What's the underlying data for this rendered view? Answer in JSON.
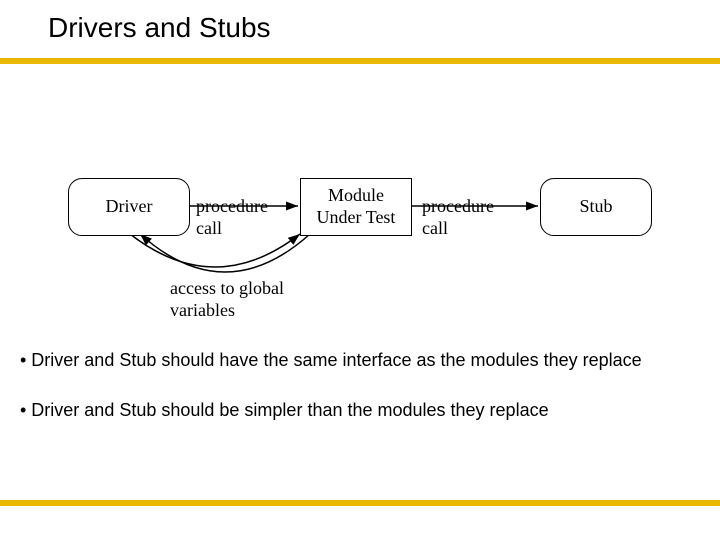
{
  "title": "Drivers and Stubs",
  "boxes": {
    "driver": "Driver",
    "module": "Module\nUnder Test",
    "stub": "Stub"
  },
  "labels": {
    "procedure_call_1": "procedure\ncall",
    "procedure_call_2": "procedure\ncall",
    "access": "access to global\nvariables"
  },
  "bullets": {
    "b1": "• Driver and Stub should have the same interface as the modules they replace",
    "b2": "• Driver and Stub should be simpler than the modules they replace"
  }
}
